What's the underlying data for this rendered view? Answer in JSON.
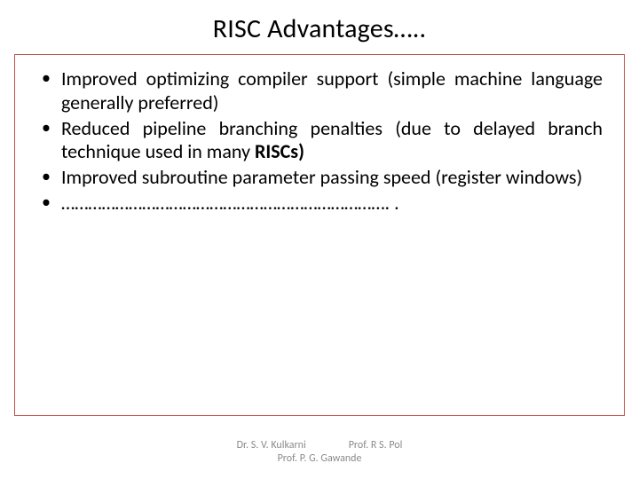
{
  "title": "RISC Advantages…..",
  "bullets": {
    "b0": "Improved optimizing compiler support (simple machine language generally preferred)",
    "b1_pre": "Reduced pipeline branching penalties (due to delayed branch technique used in many ",
    "b1_bold": "RISCs)",
    "b2": "Improved subroutine parameter passing speed (register windows)",
    "b3": "………………………………………………………………. ."
  },
  "footer": {
    "name1": "Dr. S. V. Kulkarni",
    "name2": "Prof. R S. Pol",
    "name3": "Prof. P. G. Gawande"
  }
}
